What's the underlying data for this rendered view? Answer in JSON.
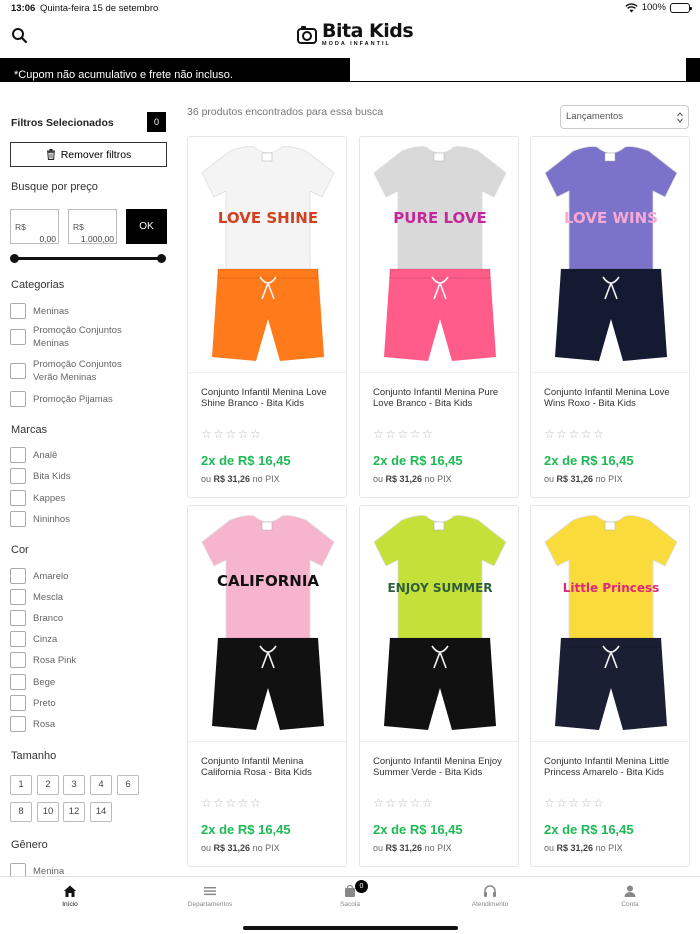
{
  "status_bar": {
    "time": "13:06",
    "date": "Quinta-feira 15 de setembro",
    "battery": "100%"
  },
  "brand": {
    "name": "Bita Kids",
    "tagline": "MODA INFANTIL"
  },
  "banner": {
    "text": "*Cupom não acumulativo e frete não incluso."
  },
  "filters": {
    "selected_title": "Filtros Selecionados",
    "selected_count": "0",
    "remove_label": "Remover filtros",
    "price_title": "Busque por preço",
    "currency": "R$",
    "min_value": "0,00",
    "max_value": "1.000,00",
    "ok_label": "OK",
    "categories_title": "Categorias",
    "categories": [
      "Meninas",
      "Promoção Conjuntos Meninas",
      "Promoção Conjuntos Verão Meninas",
      "Promoção Pijamas"
    ],
    "brands_title": "Marcas",
    "brands": [
      "Analê",
      "Bita Kids",
      "Kappes",
      "Nininhos"
    ],
    "colors_title": "Cor",
    "colors": [
      "Amarelo",
      "Mescla",
      "Branco",
      "Cinza",
      "Rosa Pink",
      "Bege",
      "Preto",
      "Rosa"
    ],
    "size_title": "Tamanho",
    "sizes": [
      "1",
      "2",
      "3",
      "4",
      "6",
      "8",
      "10",
      "12",
      "14"
    ],
    "gender_title": "Gênero",
    "gender_partial": "Menina"
  },
  "results": {
    "count_text": "36 produtos encontrados para essa busca",
    "sort_selected": "Lançamentos"
  },
  "products": [
    {
      "name": "Conjunto Infantil Menina Love Shine Branco - Bita Kids",
      "installment": "2x de R$ 16,45",
      "pix_prefix": "ou",
      "pix_price": "R$ 31,26",
      "pix_suffix": "no PIX",
      "stars": "☆☆☆☆☆",
      "shirt_color": "#f4f4f4",
      "shorts_color": "#ff7a1a",
      "print": "LOVE SHINE",
      "print_color": "#d2401f"
    },
    {
      "name": "Conjunto Infantil Menina Pure Love Branco - Bita Kids",
      "installment": "2x de R$ 16,45",
      "pix_prefix": "ou",
      "pix_price": "R$ 31,26",
      "pix_suffix": "no PIX",
      "stars": "☆☆☆☆☆",
      "shirt_color": "#d9d9d9",
      "shorts_color": "#ff5c8a",
      "print": "PURE LOVE",
      "print_color": "#c2299a"
    },
    {
      "name": "Conjunto Infantil Menina Love Wins Roxo - Bita Kids",
      "installment": "2x de R$ 16,45",
      "pix_prefix": "ou",
      "pix_price": "R$ 31,26",
      "pix_suffix": "no PIX",
      "stars": "☆☆☆☆☆",
      "shirt_color": "#7b73c9",
      "shorts_color": "#151a33",
      "print": "LOVE WINS",
      "print_color": "#f7a8d6"
    },
    {
      "name": "Conjunto Infantil Menina California Rosa - Bita Kids",
      "installment": "2x de R$ 16,45",
      "pix_prefix": "ou",
      "pix_price": "R$ 31,26",
      "pix_suffix": "no PIX",
      "stars": "☆☆☆☆☆",
      "shirt_color": "#f7b4cd",
      "shorts_color": "#111111",
      "print": "CALIFORNIA",
      "print_color": "#111111"
    },
    {
      "name": "Conjunto Infantil Menina Enjoy Summer Verde - Bita Kids",
      "installment": "2x de R$ 16,45",
      "pix_prefix": "ou",
      "pix_price": "R$ 31,26",
      "pix_suffix": "no PIX",
      "stars": "☆☆☆☆☆",
      "shirt_color": "#c6e03a",
      "shorts_color": "#111111",
      "print": "ENJOY SUMMER",
      "print_color": "#2f5f3a"
    },
    {
      "name": "Conjunto Infantil Menina Little Princess Amarelo - Bita Kids",
      "installment": "2x de R$ 16,45",
      "pix_prefix": "ou",
      "pix_price": "R$ 31,26",
      "pix_suffix": "no PIX",
      "stars": "☆☆☆☆☆",
      "shirt_color": "#f9dc3c",
      "shorts_color": "#1a1f33",
      "print": "Little Princess",
      "print_color": "#e0287a"
    }
  ],
  "tabbar": {
    "items": [
      "Início",
      "Departamentos",
      "Sacola",
      "Atendimento",
      "Conta"
    ],
    "cart_count": "0"
  }
}
